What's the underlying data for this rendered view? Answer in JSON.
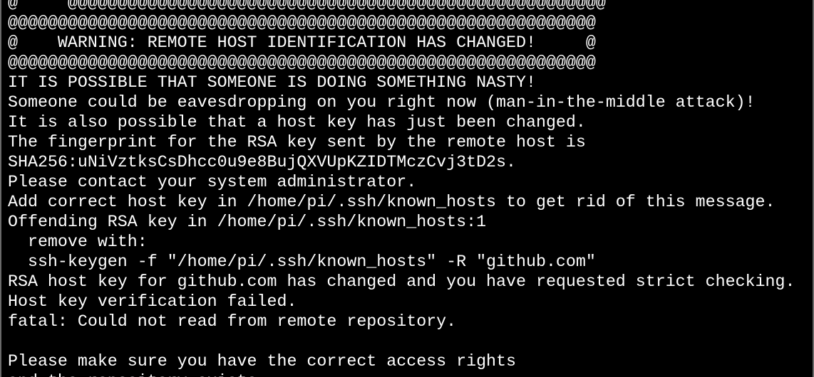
{
  "terminal": {
    "lines": [
      "@     @@@@@@@@@@@@@@@@@@@@@@@@@@@@@@@@@@@@@@@@@@@@@@@@@@@@@@",
      "@@@@@@@@@@@@@@@@@@@@@@@@@@@@@@@@@@@@@@@@@@@@@@@@@@@@@@@@@@@",
      "@    WARNING: REMOTE HOST IDENTIFICATION HAS CHANGED!     @",
      "@@@@@@@@@@@@@@@@@@@@@@@@@@@@@@@@@@@@@@@@@@@@@@@@@@@@@@@@@@@",
      "IT IS POSSIBLE THAT SOMEONE IS DOING SOMETHING NASTY!",
      "Someone could be eavesdropping on you right now (man-in-the-middle attack)!",
      "It is also possible that a host key has just been changed.",
      "The fingerprint for the RSA key sent by the remote host is",
      "SHA256:uNiVztksCsDhcc0u9e8BujQXVUpKZIDTMczCvj3tD2s.",
      "Please contact your system administrator.",
      "Add correct host key in /home/pi/.ssh/known_hosts to get rid of this message.",
      "Offending RSA key in /home/pi/.ssh/known_hosts:1",
      "  remove with:",
      "  ssh-keygen -f \"/home/pi/.ssh/known_hosts\" -R \"github.com\"",
      "RSA host key for github.com has changed and you have requested strict checking.",
      "Host key verification failed.",
      "fatal: Could not read from remote repository.",
      "",
      "Please make sure you have the correct access rights",
      "and the repository exists."
    ]
  },
  "colors": {
    "background": "#000000",
    "text": "#ffffff",
    "frame": "#6a6a6a"
  }
}
